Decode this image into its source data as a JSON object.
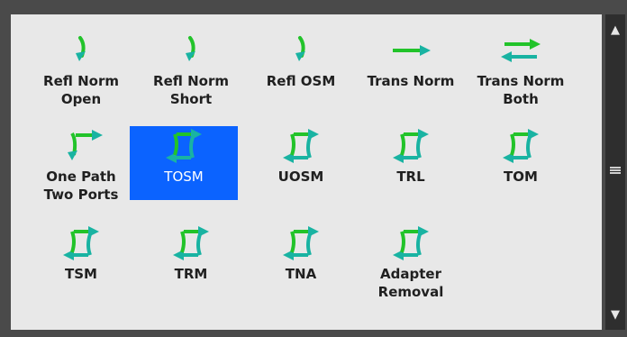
{
  "colors": {
    "background": "#e8e8e8",
    "selection": "#0b63ff",
    "icon_green": "#22c32a",
    "icon_teal": "#19b3a2",
    "scrollbar": "#2e2e2e"
  },
  "items": [
    {
      "label": "Refl Norm\nOpen",
      "icon": "refl-curve-icon",
      "selected": false
    },
    {
      "label": "Refl Norm\nShort",
      "icon": "refl-curve-icon",
      "selected": false
    },
    {
      "label": "Refl OSM",
      "icon": "refl-curve-icon",
      "selected": false
    },
    {
      "label": "Trans Norm",
      "icon": "right-arrow-icon",
      "selected": false
    },
    {
      "label": "Trans Norm\nBoth",
      "icon": "double-arrow-icon",
      "selected": false
    },
    {
      "label": "One Path\nTwo Ports",
      "icon": "one-path-icon",
      "selected": false
    },
    {
      "label": "TOSM",
      "icon": "two-port-cal-icon",
      "selected": true
    },
    {
      "label": "UOSM",
      "icon": "two-port-cal-icon",
      "selected": false
    },
    {
      "label": "TRL",
      "icon": "two-port-cal-icon",
      "selected": false
    },
    {
      "label": "TOM",
      "icon": "two-port-cal-icon",
      "selected": false
    },
    {
      "label": "TSM",
      "icon": "two-port-cal-icon",
      "selected": false
    },
    {
      "label": "TRM",
      "icon": "two-port-cal-icon",
      "selected": false
    },
    {
      "label": "TNA",
      "icon": "two-port-cal-icon",
      "selected": false
    },
    {
      "label": "Adapter\nRemoval",
      "icon": "two-port-cal-icon",
      "selected": false
    }
  ],
  "scrollbar": {
    "up_icon": "▲",
    "down_icon": "▼",
    "grip_icon": "scroll-grip-icon"
  }
}
